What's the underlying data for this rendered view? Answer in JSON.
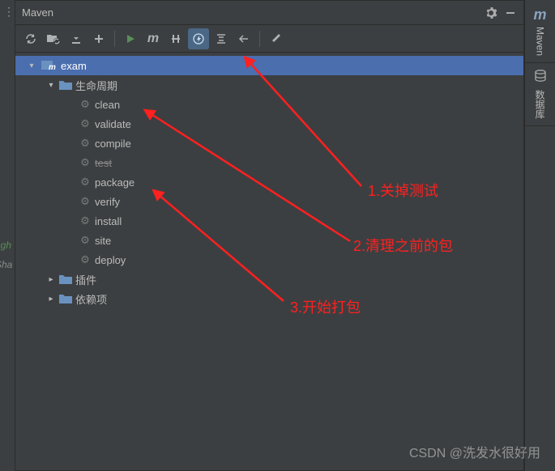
{
  "header": {
    "title": "Maven"
  },
  "toolbar": {
    "buttons": [
      {
        "name": "refresh-icon"
      },
      {
        "name": "folders-icon"
      },
      {
        "name": "download-icon"
      },
      {
        "name": "plus-icon"
      },
      {
        "name": "play-icon"
      },
      {
        "name": "m-icon"
      },
      {
        "name": "skip-icon"
      },
      {
        "name": "toggle-skip-tests-icon",
        "active": true
      },
      {
        "name": "collapse-icon"
      },
      {
        "name": "show-icon"
      },
      {
        "name": "settings-icon"
      }
    ]
  },
  "tree": {
    "project": "exam",
    "lifecycle_label": "生命周期",
    "items": [
      {
        "label": "clean",
        "strike": false
      },
      {
        "label": "validate",
        "strike": false
      },
      {
        "label": "compile",
        "strike": false
      },
      {
        "label": "test",
        "strike": true
      },
      {
        "label": "package",
        "strike": false
      },
      {
        "label": "verify",
        "strike": false
      },
      {
        "label": "install",
        "strike": false
      },
      {
        "label": "site",
        "strike": false
      },
      {
        "label": "deploy",
        "strike": false
      }
    ],
    "plugins_label": "插件",
    "deps_label": "依赖项"
  },
  "right_sidebar": {
    "maven_label": "Maven",
    "db_label": "数据库"
  },
  "annotations": {
    "a1": "1.关掉测试",
    "a2": "2.清理之前的包",
    "a3": "3.开始打包"
  },
  "left_edge": {
    "t1": "ngh",
    "t2": "Sha"
  },
  "watermark": "CSDN @洗发水很好用"
}
